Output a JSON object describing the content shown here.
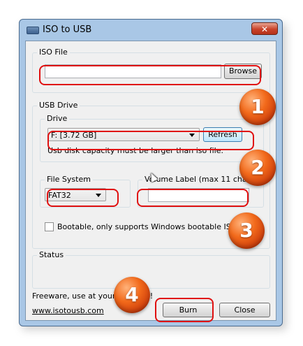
{
  "window": {
    "title": "ISO to USB",
    "close_glyph": "✕"
  },
  "iso_file": {
    "group_label": "ISO File",
    "path_value": "",
    "browse_label": "Browse"
  },
  "usb_drive": {
    "group_label": "USB Drive",
    "drive_group_label": "Drive",
    "drive_selected": "F: [3.72 GB]",
    "refresh_label": "Refresh",
    "capacity_note": "Usb disk capacity must be larger than iso file."
  },
  "file_system": {
    "label": "File System",
    "selected": "FAT32"
  },
  "volume_label": {
    "label": "Volume Label (max 11 chars)",
    "value": ""
  },
  "bootable": {
    "label": "Bootable, only supports Windows bootable ISO image",
    "checked": false
  },
  "status": {
    "group_label": "Status",
    "text": ""
  },
  "footer": {
    "freeware_text": "Freeware, use at your own risk!",
    "link_text": "www.isotousb.com",
    "burn_label": "Burn",
    "close_label": "Close"
  },
  "badges": [
    "1",
    "2",
    "3",
    "4"
  ],
  "colors": {
    "annotation_red": "#e01010",
    "badge_orange": "#f26a1b",
    "titlebar": "#a9c7e6"
  }
}
